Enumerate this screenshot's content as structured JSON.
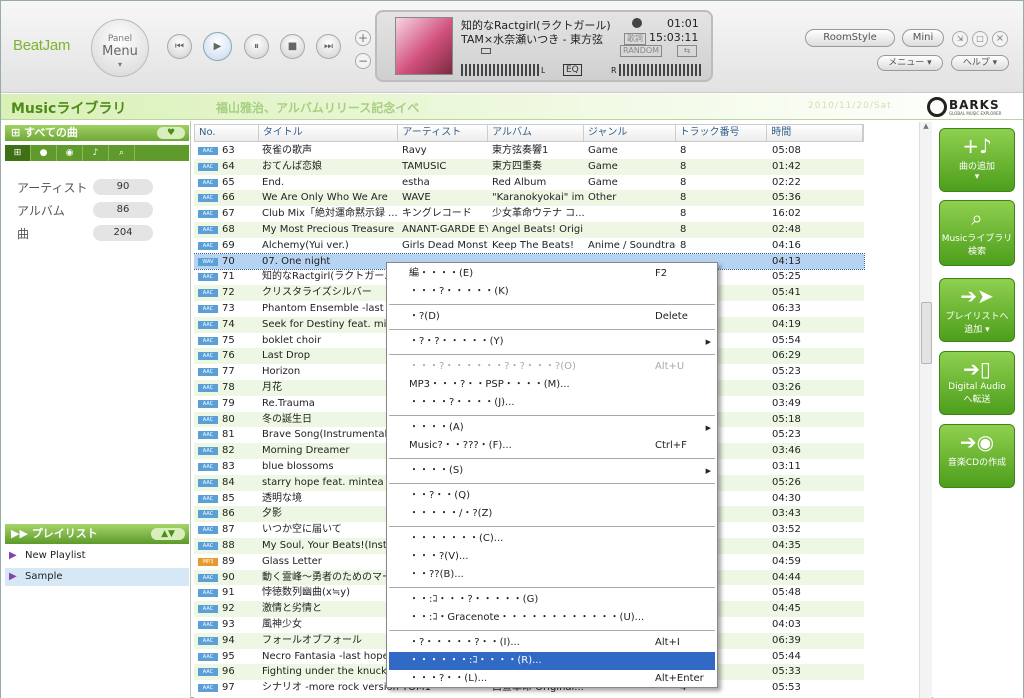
{
  "app": {
    "logo": "BeatJam",
    "panel_small": "Panel",
    "panel_big": "Menu",
    "panel_arrow": "▾"
  },
  "player": {
    "prev": "⏮",
    "play": "▶",
    "pause": "⏸",
    "stop": "■",
    "next": "⏭",
    "plus": "+",
    "minus": "−"
  },
  "nowplaying": {
    "title": "知的なRactgirl(ラクトガール)",
    "artist_album": "TAM×水奈瀬いつき - 東方弦",
    "elapsed": "01:01",
    "total": "15:03:11",
    "lyrics": "歌詞",
    "random": "RANDOM",
    "eq": "EQ",
    "l": "L",
    "r": "R"
  },
  "window_buttons": {
    "roomstyle": "RoomStyle",
    "mini": "Mini",
    "menu": "メニュー",
    "help": "ヘルプ",
    "min": "_",
    "max": "□",
    "close": "×",
    "shrink": "⇲"
  },
  "banner": {
    "title": "Musicライブラリ",
    "news": "福山雅治、アルバムリリース記念イベ",
    "date": "2010/11/20/Sat",
    "brand": "BARKS",
    "brand_sub": "GLOBAL MUSIC EXPLORER"
  },
  "sidebar": {
    "all_songs": "すべての曲",
    "heart": "♥",
    "stats": [
      {
        "label": "アーティスト",
        "value": "90"
      },
      {
        "label": "アルバム",
        "value": "86"
      },
      {
        "label": "曲",
        "value": "204"
      }
    ],
    "playlist_header": "プレイリスト",
    "playlists": [
      "New Playlist",
      "Sample"
    ],
    "tab_icons": [
      "⊞",
      "●",
      "◉",
      "♪",
      "⌕"
    ]
  },
  "table": {
    "columns": [
      "No.",
      "タイトル",
      "アーティスト",
      "アルバム",
      "ジャンル",
      "トラック番号",
      "時間"
    ],
    "rows": [
      {
        "type": "AAC",
        "no": "63",
        "title": "夜雀の歌声",
        "artist": "Ravy",
        "album": "東方弦奏響1",
        "genre": "Game",
        "track": "8",
        "time": "05:08"
      },
      {
        "type": "AAC",
        "no": "64",
        "title": "おてんば恋娘",
        "artist": "TAMUSIC",
        "album": "東方四重奏",
        "genre": "Game",
        "track": "8",
        "time": "01:42"
      },
      {
        "type": "AAC",
        "no": "65",
        "title": "End.",
        "artist": "estha",
        "album": "Red Album",
        "genre": "Game",
        "track": "8",
        "time": "02:22"
      },
      {
        "type": "AAC",
        "no": "66",
        "title": "We Are Only Who We Are",
        "artist": "WAVE",
        "album": "\"Karanokyokai\" im...",
        "genre": "Other",
        "track": "8",
        "time": "05:36"
      },
      {
        "type": "AAC",
        "no": "67",
        "title": "Club Mix「絶対運命黙示録 ...",
        "artist": "キングレコード",
        "album": "少女革命ウテナ コ...",
        "genre": "",
        "track": "8",
        "time": "16:02"
      },
      {
        "type": "AAC",
        "no": "68",
        "title": "My Most Precious Treasure",
        "artist": "ANANT-GARDE EY...",
        "album": "Angel Beats! Origi...",
        "genre": "",
        "track": "8",
        "time": "02:48"
      },
      {
        "type": "AAC",
        "no": "69",
        "title": "Alchemy(Yui ver.)",
        "artist": "Girls Dead Monster",
        "album": "Keep The Beats!",
        "genre": "Anime / Soundtrack",
        "track": "8",
        "time": "04:16"
      },
      {
        "type": "WAV",
        "no": "70",
        "title": "07. One night",
        "artist": "",
        "album": "",
        "genre": "",
        "track": "",
        "time": "04:13"
      },
      {
        "type": "AAC",
        "no": "71",
        "title": "知的なRactgirl(ラクトガール)",
        "artist": "",
        "album": "",
        "genre": "",
        "track": "",
        "time": "05:25"
      },
      {
        "type": "AAC",
        "no": "72",
        "title": "クリスタライズシルバー",
        "artist": "",
        "album": "",
        "genre": "",
        "track": "",
        "time": "05:41"
      },
      {
        "type": "AAC",
        "no": "73",
        "title": "Phantom Ensemble -last hop",
        "artist": "",
        "album": "",
        "genre": "",
        "track": "",
        "time": "06:33"
      },
      {
        "type": "AAC",
        "no": "74",
        "title": "Seek for Destiny feat. minte",
        "artist": "",
        "album": "",
        "genre": "",
        "track": "",
        "time": "04:19"
      },
      {
        "type": "AAC",
        "no": "75",
        "title": "boklet choir",
        "artist": "",
        "album": "",
        "genre": "",
        "track": "",
        "time": "05:54"
      },
      {
        "type": "AAC",
        "no": "76",
        "title": "Last Drop",
        "artist": "",
        "album": "",
        "genre": "",
        "track": "",
        "time": "06:29"
      },
      {
        "type": "AAC",
        "no": "77",
        "title": "Horizon",
        "artist": "",
        "album": "",
        "genre": "",
        "track": "",
        "time": "05:23"
      },
      {
        "type": "AAC",
        "no": "78",
        "title": "月花",
        "artist": "",
        "album": "",
        "genre": "",
        "track": "",
        "time": "03:26"
      },
      {
        "type": "AAC",
        "no": "79",
        "title": "Re.Trauma",
        "artist": "",
        "album": "",
        "genre": "",
        "track": "",
        "time": "03:49"
      },
      {
        "type": "AAC",
        "no": "80",
        "title": "冬の誕生日",
        "artist": "",
        "album": "",
        "genre": "",
        "track": "",
        "time": "05:18"
      },
      {
        "type": "AAC",
        "no": "81",
        "title": "Brave Song(Instrumental)",
        "artist": "",
        "album": "",
        "genre": "",
        "track": "",
        "time": "05:23"
      },
      {
        "type": "AAC",
        "no": "82",
        "title": "Morning Dreamer",
        "artist": "",
        "album": "",
        "genre": "",
        "track": "",
        "time": "03:46"
      },
      {
        "type": "AAC",
        "no": "83",
        "title": "blue blossoms",
        "artist": "",
        "album": "",
        "genre": "",
        "track": "",
        "time": "03:11"
      },
      {
        "type": "AAC",
        "no": "84",
        "title": "starry hope feat. mintea",
        "artist": "",
        "album": "",
        "genre": "",
        "track": "",
        "time": "05:26"
      },
      {
        "type": "AAC",
        "no": "85",
        "title": "透明な境",
        "artist": "",
        "album": "",
        "genre": "",
        "track": "",
        "time": "04:30"
      },
      {
        "type": "AAC",
        "no": "86",
        "title": "夕影",
        "artist": "",
        "album": "",
        "genre": "",
        "track": "",
        "time": "03:43"
      },
      {
        "type": "AAC",
        "no": "87",
        "title": "いつか空に届いて",
        "artist": "",
        "album": "",
        "genre": "",
        "track": "",
        "time": "03:52"
      },
      {
        "type": "AAC",
        "no": "88",
        "title": "My Soul, Your Beats!(Instru",
        "artist": "",
        "album": "",
        "genre": "",
        "track": "",
        "time": "04:35"
      },
      {
        "type": "MP3",
        "no": "89",
        "title": "Glass Letter",
        "artist": "",
        "album": "",
        "genre": "",
        "track": "",
        "time": "04:59"
      },
      {
        "type": "AAC",
        "no": "90",
        "title": "動く霊峰～勇者のためのマー",
        "artist": "",
        "album": "",
        "genre": "",
        "track": "",
        "time": "04:44"
      },
      {
        "type": "AAC",
        "no": "91",
        "title": "悖徳数列幽曲(x≒y)",
        "artist": "",
        "album": "",
        "genre": "",
        "track": "",
        "time": "05:48"
      },
      {
        "type": "AAC",
        "no": "92",
        "title": "激情と劣情と",
        "artist": "",
        "album": "",
        "genre": "",
        "track": "",
        "time": "04:45"
      },
      {
        "type": "AAC",
        "no": "93",
        "title": "風神少女",
        "artist": "",
        "album": "",
        "genre": "",
        "track": "",
        "time": "04:03"
      },
      {
        "type": "AAC",
        "no": "94",
        "title": "フォールオブフォール",
        "artist": "",
        "album": "",
        "genre": "",
        "track": "",
        "time": "06:39"
      },
      {
        "type": "AAC",
        "no": "95",
        "title": "Necro Fantasia -last hope m",
        "artist": "",
        "album": "",
        "genre": "",
        "track": "",
        "time": "05:44"
      },
      {
        "type": "AAC",
        "no": "96",
        "title": "Fighting under the knuckle",
        "artist": "",
        "album": "",
        "genre": "",
        "track": "",
        "time": "05:33"
      },
      {
        "type": "AAC",
        "no": "97",
        "title": "シナリオ -more rock version-",
        "artist": "TOM1",
        "album": "白昼革命 Original...",
        "genre": "",
        "track": "4",
        "time": "05:53"
      }
    ]
  },
  "context_menu": {
    "items": [
      {
        "label": "編・・・・(E)",
        "key": "F2"
      },
      {
        "label": "・・・?・・・・・(K)",
        "key": ""
      },
      {
        "sep": true
      },
      {
        "label": "・?(D)",
        "key": "Delete"
      },
      {
        "sep": true
      },
      {
        "label": "・?・?・・・・・(Y)",
        "key": "",
        "arrow": true
      },
      {
        "sep": true
      },
      {
        "label": "・・・?・・・・・・?・?・・・?(O)",
        "key": "Alt+U",
        "disabled": true
      },
      {
        "label": "MP3・・・?・・PSP・・・・(M)...",
        "key": ""
      },
      {
        "label": "・・・・?・・・・(J)...",
        "key": ""
      },
      {
        "sep": true
      },
      {
        "label": "・・・・(A)",
        "key": "",
        "arrow": true
      },
      {
        "label": "Music?・・???・(F)...",
        "key": "Ctrl+F"
      },
      {
        "sep": true
      },
      {
        "label": "・・・・(S)",
        "key": "",
        "arrow": true
      },
      {
        "sep": true
      },
      {
        "label": "・・?・・(Q)",
        "key": ""
      },
      {
        "label": "・・・・・/・?(Z)",
        "key": ""
      },
      {
        "sep": true
      },
      {
        "label": "・・・・・・・(C)...",
        "key": ""
      },
      {
        "label": "・・・?(V)...",
        "key": ""
      },
      {
        "label": "・・??(B)...",
        "key": ""
      },
      {
        "sep": true
      },
      {
        "label": "・・:ｺ・・・?・・・・・(G)",
        "key": ""
      },
      {
        "label": "・・:ｺ・Gracenote・・・・・・・・・・・・(U)...",
        "key": ""
      },
      {
        "sep": true
      },
      {
        "label": "・?・・・・・?・・(I)...",
        "key": "Alt+I"
      },
      {
        "label": "・・・・・・:ｺ・・・・(R)...",
        "key": "",
        "highlight": true
      },
      {
        "label": "・・・?・・(L)...",
        "key": "Alt+Enter"
      }
    ]
  },
  "actions": [
    {
      "icon": "+♪",
      "label1": "曲の追加",
      "label2": "▾"
    },
    {
      "icon": "⌕",
      "label1": "Musicライブラリ",
      "label2": "検索"
    },
    {
      "icon": "➔➤",
      "label1": "プレイリストへ",
      "label2": "追加 ▾"
    },
    {
      "icon": "➔▯",
      "label1": "Digital Audio",
      "label2": "へ転送"
    },
    {
      "icon": "➔◉",
      "label1": "音楽CDの作成",
      "label2": ""
    }
  ]
}
